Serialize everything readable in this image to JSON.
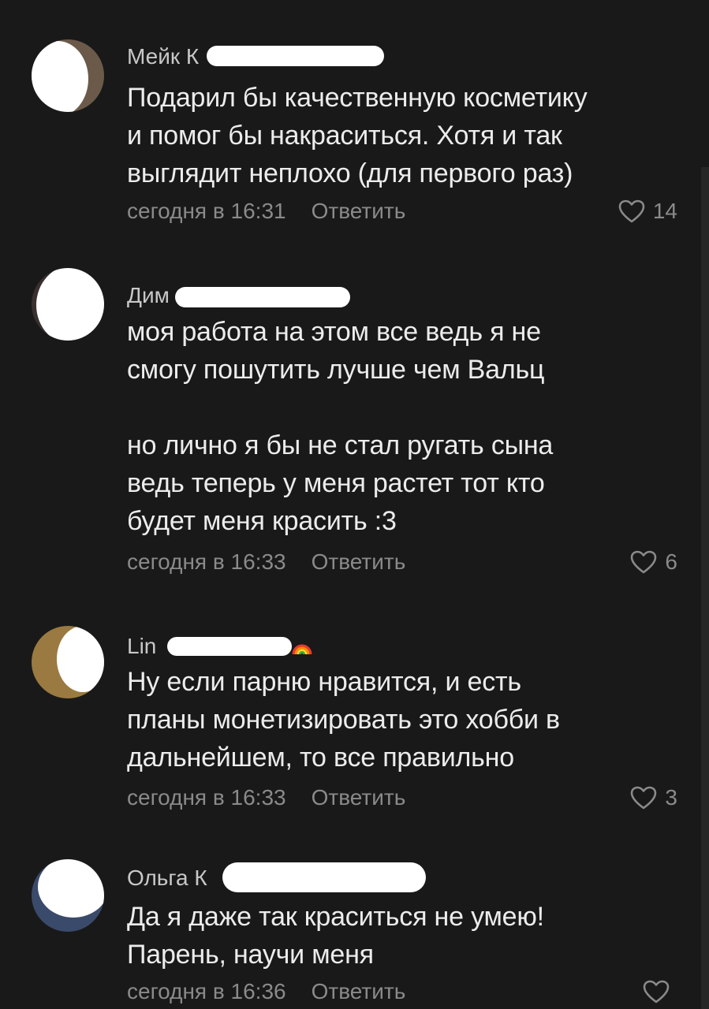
{
  "reply_label": "Ответить",
  "comments": [
    {
      "author": "Мейк К",
      "text": "Подарил бы качественную косметику\nи помог бы накраситься. Хотя и так\nвыглядит неплохо (для первого раз)",
      "time": "сегодня в 16:31",
      "likes": "14",
      "avatar_color": "#6b5a4a"
    },
    {
      "author": "Дим",
      "text": "моя работа на этом все  ведь  я не\nсмогу пошутить лучше  чем Вальц\n\nно лично я бы не стал ругать сына\nведь теперь у меня растет  тот кто\nбудет меня красить :3",
      "time": "сегодня в 16:33",
      "likes": "6",
      "avatar_color": "#3a3030"
    },
    {
      "author": "Lin",
      "text": "Ну если парню нравится, и есть\nпланы монетизировать это хобби в\nдальнейшем, то все правильно",
      "time": "сегодня в 16:33",
      "likes": "3",
      "avatar_color": "#9a7a40"
    },
    {
      "author": "Ольга К",
      "text": "Да я даже так краситься не умею!\nПарень, научи меня",
      "time": "сегодня в 16:36",
      "likes": "",
      "avatar_color": "#3a4a6a"
    }
  ],
  "colors": {
    "background": "#191919",
    "text": "#ececec",
    "secondary": "#8a8a8a"
  },
  "icons": {
    "like": "heart-outline-icon",
    "emoji": "rainbow-icon"
  }
}
